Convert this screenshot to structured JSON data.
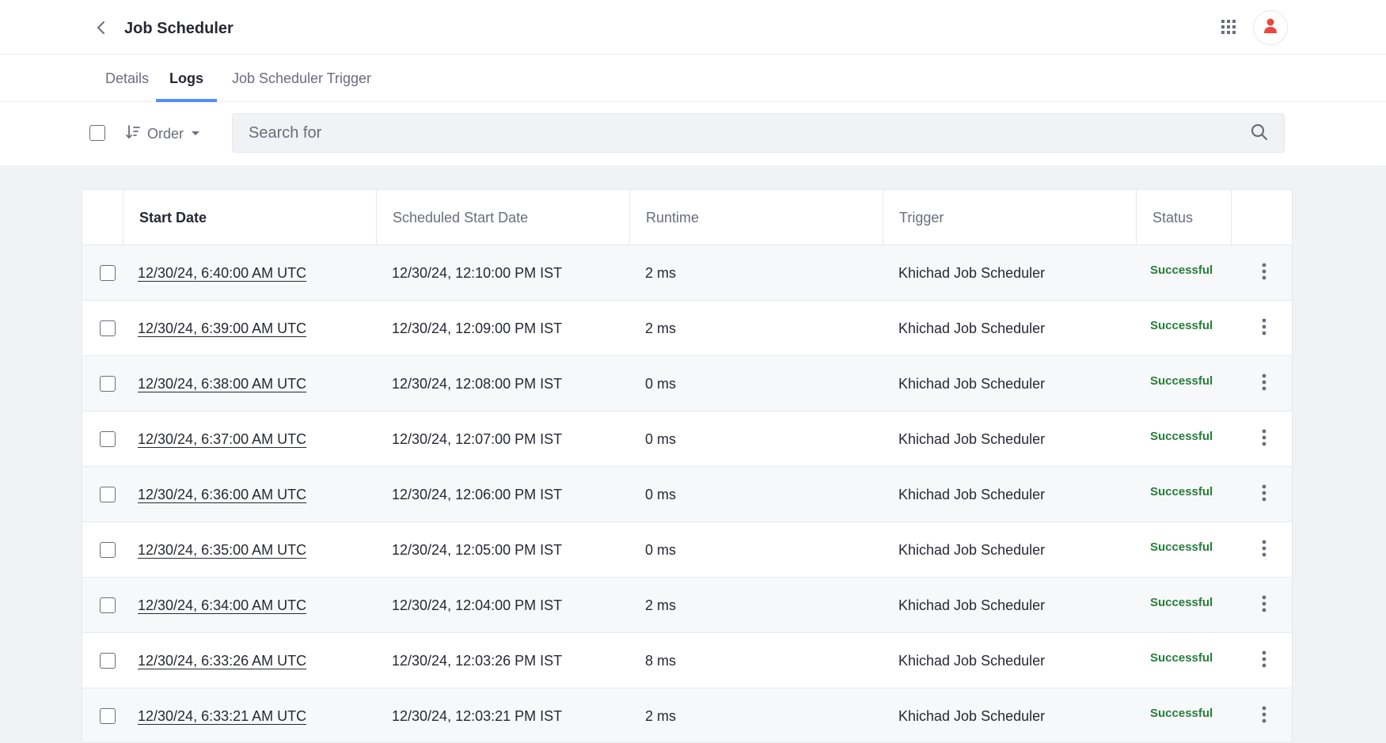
{
  "header": {
    "title": "Job Scheduler",
    "back_icon": "chevron-left-icon",
    "apps_icon": "grid-icon",
    "avatar_icon": "user-icon",
    "avatar_color": "#e8483f"
  },
  "tabs": [
    {
      "label": "Details",
      "active": false
    },
    {
      "label": "Logs",
      "active": true
    },
    {
      "label": "Job Scheduler Trigger",
      "active": false
    }
  ],
  "toolbar": {
    "order_label": "Order",
    "search_placeholder": "Search for",
    "search_icon": "search-icon"
  },
  "table": {
    "columns": [
      "Start Date",
      "Scheduled Start Date",
      "Runtime",
      "Trigger",
      "Status"
    ],
    "rows": [
      {
        "start": "12/30/24, 6:40:00 AM UTC",
        "scheduled": "12/30/24, 12:10:00 PM IST",
        "runtime": "2 ms",
        "trigger": "Khichad Job Scheduler",
        "status": "Successful"
      },
      {
        "start": "12/30/24, 6:39:00 AM UTC",
        "scheduled": "12/30/24, 12:09:00 PM IST",
        "runtime": "2 ms",
        "trigger": "Khichad Job Scheduler",
        "status": "Successful"
      },
      {
        "start": "12/30/24, 6:38:00 AM UTC",
        "scheduled": "12/30/24, 12:08:00 PM IST",
        "runtime": "0 ms",
        "trigger": "Khichad Job Scheduler",
        "status": "Successful"
      },
      {
        "start": "12/30/24, 6:37:00 AM UTC",
        "scheduled": "12/30/24, 12:07:00 PM IST",
        "runtime": "0 ms",
        "trigger": "Khichad Job Scheduler",
        "status": "Successful"
      },
      {
        "start": "12/30/24, 6:36:00 AM UTC",
        "scheduled": "12/30/24, 12:06:00 PM IST",
        "runtime": "0 ms",
        "trigger": "Khichad Job Scheduler",
        "status": "Successful"
      },
      {
        "start": "12/30/24, 6:35:00 AM UTC",
        "scheduled": "12/30/24, 12:05:00 PM IST",
        "runtime": "0 ms",
        "trigger": "Khichad Job Scheduler",
        "status": "Successful"
      },
      {
        "start": "12/30/24, 6:34:00 AM UTC",
        "scheduled": "12/30/24, 12:04:00 PM IST",
        "runtime": "2 ms",
        "trigger": "Khichad Job Scheduler",
        "status": "Successful"
      },
      {
        "start": "12/30/24, 6:33:26 AM UTC",
        "scheduled": "12/30/24, 12:03:26 PM IST",
        "runtime": "8 ms",
        "trigger": "Khichad Job Scheduler",
        "status": "Successful"
      },
      {
        "start": "12/30/24, 6:33:21 AM UTC",
        "scheduled": "12/30/24, 12:03:21 PM IST",
        "runtime": "2 ms",
        "trigger": "Khichad Job Scheduler",
        "status": "Successful"
      }
    ],
    "status_color": "#287d3c",
    "row_action_icon": "ellipsis-vertical-icon"
  }
}
